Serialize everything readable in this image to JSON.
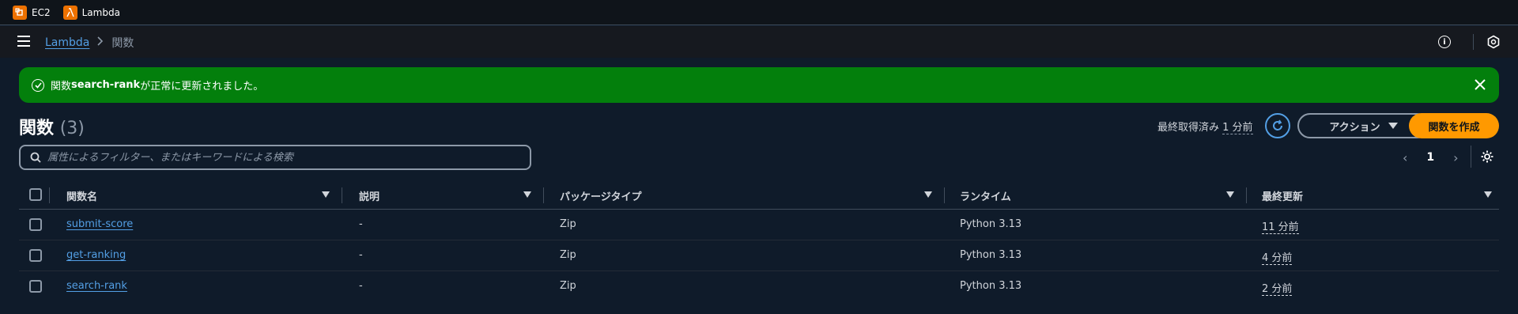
{
  "favorites": [
    {
      "label": "EC2",
      "icon": "ec2-icon"
    },
    {
      "label": "Lambda",
      "icon": "lambda-icon"
    }
  ],
  "breadcrumb": {
    "parent": "Lambda",
    "current": "関数"
  },
  "flash": {
    "prefix": "関数 ",
    "function_name": "search-rank",
    "suffix": " が正常に更新されました。",
    "color": "#037f0c"
  },
  "header": {
    "title": "関数",
    "count": "(3)",
    "last_fetch_label": "最終取得済み ",
    "last_fetch_value": "1 分前",
    "actions_label": "アクション",
    "create_label": "関数を作成"
  },
  "search": {
    "placeholder": "属性によるフィルター、またはキーワードによる検索"
  },
  "pagination": {
    "current_page": "1",
    "prev": "‹",
    "next": "›"
  },
  "table": {
    "columns": [
      "関数名",
      "説明",
      "パッケージタイプ",
      "ランタイム",
      "最終更新"
    ],
    "rows": [
      {
        "name": "submit-score",
        "description": "-",
        "package_type": "Zip",
        "runtime": "Python 3.13",
        "last_modified": "11 分前"
      },
      {
        "name": "get-ranking",
        "description": "-",
        "package_type": "Zip",
        "runtime": "Python 3.13",
        "last_modified": "4 分前"
      },
      {
        "name": "search-rank",
        "description": "-",
        "package_type": "Zip",
        "runtime": "Python 3.13",
        "last_modified": "2 分前"
      }
    ]
  },
  "colors": {
    "accent": "#ff9900",
    "link": "#539fe5",
    "success": "#037f0c",
    "background": "#0f1b2a"
  }
}
